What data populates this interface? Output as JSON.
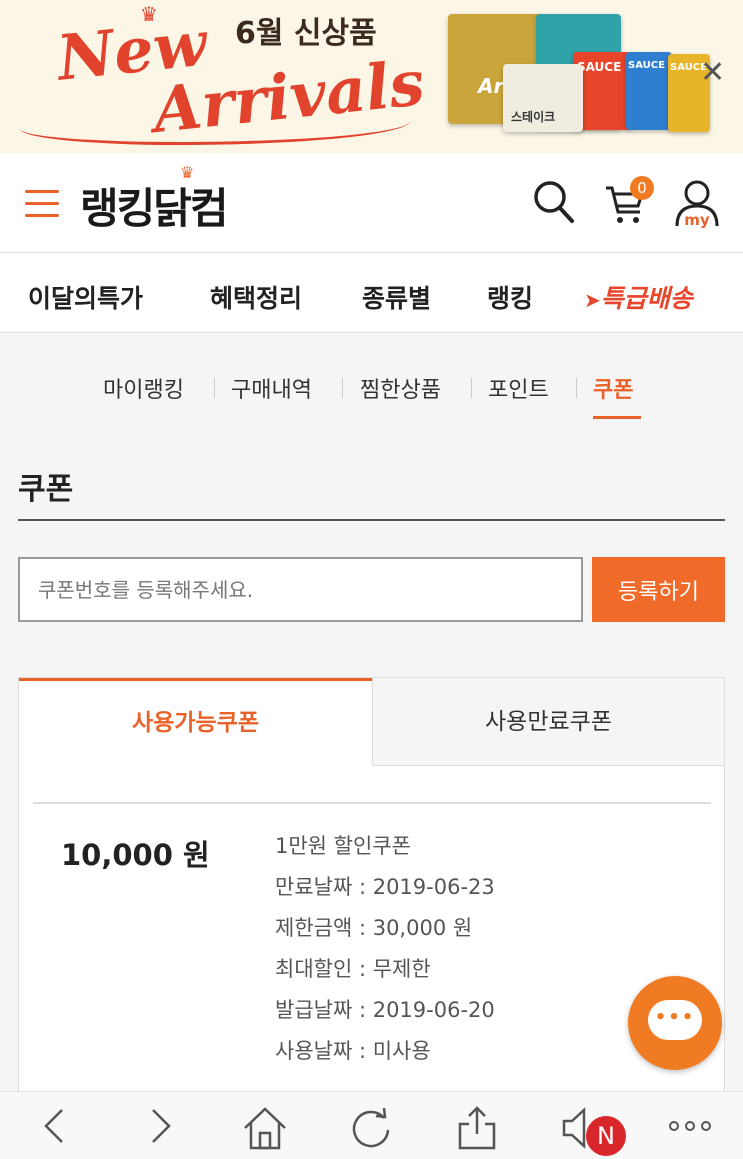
{
  "banner": {
    "script_line1": "New",
    "script_line2": "Arrivals",
    "promo_text": "6월 신상품",
    "packages": [
      {
        "label": "Arr",
        "color": "#c9a53b"
      },
      {
        "label": "SAUCE",
        "color": "#2fa3a8"
      },
      {
        "label": "SAUCE",
        "color": "#e8452a"
      },
      {
        "label": "SAUCE",
        "color": "#e8b52a"
      },
      {
        "label": "스테이크",
        "color": "#f0ede0"
      }
    ],
    "close_icon": "close-icon"
  },
  "header": {
    "logo": "랭킹닭컴",
    "cart_count": "0",
    "my_label": "my"
  },
  "nav": {
    "items": [
      "이달의특가",
      "혜택정리",
      "종류별",
      "랭킹"
    ],
    "express": "특급배송"
  },
  "subnav": {
    "items": [
      "마이랭킹",
      "구매내역",
      "찜한상품",
      "포인트",
      "쿠폰"
    ]
  },
  "page": {
    "title": "쿠폰"
  },
  "register": {
    "placeholder": "쿠폰번호를 등록해주세요.",
    "button": "등록하기"
  },
  "tabs": {
    "active": "사용가능쿠폰",
    "inactive": "사용만료쿠폰"
  },
  "coupon": {
    "amount": "10,000 원",
    "name": "1만원 할인쿠폰",
    "expiry": "만료날짜 : 2019-06-23",
    "min_amount": "제한금액 : 30,000 원",
    "max_discount": "최대할인 : 무제한",
    "issued": "발급날짜 : 2019-06-20",
    "used": "사용날짜 : 미사용"
  },
  "browser": {
    "n_badge": "N"
  },
  "colors": {
    "accent": "#e8622a",
    "button": "#f06a2a",
    "badge_red": "#d8262b"
  }
}
